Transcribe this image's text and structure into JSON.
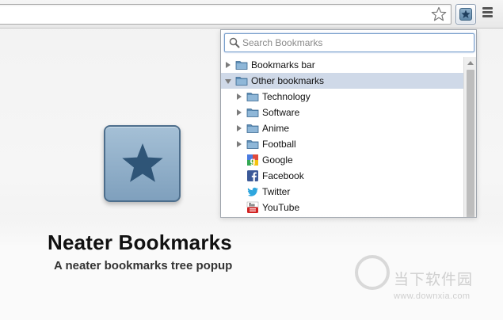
{
  "toolbar": {
    "bookmark_star_icon": "star-outline-icon",
    "extension_icon": "neater-bookmarks-icon",
    "menu_icon": "hamburger-menu-icon"
  },
  "popup": {
    "search_placeholder": "Search Bookmarks",
    "items": [
      {
        "label": "Bookmarks bar",
        "icon": "folder-icon",
        "expander": "collapsed"
      },
      {
        "label": "Other bookmarks",
        "icon": "folder-icon",
        "expander": "expanded",
        "selected": true
      },
      {
        "label": "Technology",
        "icon": "folder-icon",
        "expander": "collapsed"
      },
      {
        "label": "Software",
        "icon": "folder-icon",
        "expander": "collapsed"
      },
      {
        "label": "Anime",
        "icon": "folder-icon",
        "expander": "collapsed"
      },
      {
        "label": "Football",
        "icon": "folder-icon",
        "expander": "collapsed"
      },
      {
        "label": "Google",
        "icon": "google-favicon-icon"
      },
      {
        "label": "Facebook",
        "icon": "facebook-favicon-icon"
      },
      {
        "label": "Twitter",
        "icon": "twitter-favicon-icon"
      },
      {
        "label": "YouTube",
        "icon": "youtube-favicon-icon"
      }
    ]
  },
  "hero": {
    "title": "Neater Bookmarks",
    "subtitle": "A neater bookmarks tree popup"
  },
  "watermark": {
    "name": "当下软件园",
    "url": "www.downxia.com"
  },
  "colors": {
    "selected_row": "#cfd9e8",
    "icon_blue": "#8fb0cb",
    "star_dark": "#2f5577"
  }
}
